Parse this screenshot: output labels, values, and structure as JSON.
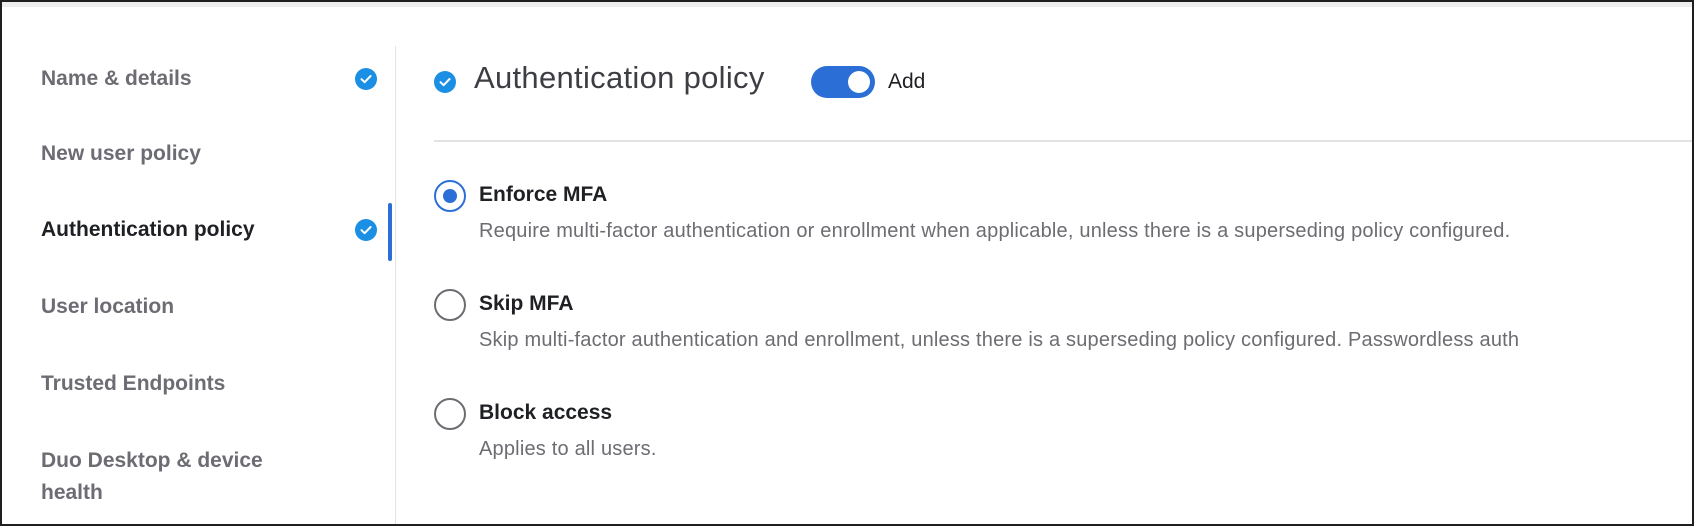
{
  "sidebar": {
    "items": [
      {
        "label": "Name & details",
        "checked": true,
        "active": false
      },
      {
        "label": "New user policy",
        "checked": false,
        "active": false
      },
      {
        "label": "Authentication policy",
        "checked": true,
        "active": true
      },
      {
        "label": "User location",
        "checked": false,
        "active": false
      },
      {
        "label": "Trusted Endpoints",
        "checked": false,
        "active": false
      },
      {
        "label": "Duo Desktop & device health",
        "checked": false,
        "active": false
      }
    ]
  },
  "header": {
    "title": "Authentication policy",
    "toggle_label": "Add",
    "toggle_on": true
  },
  "options": [
    {
      "title": "Enforce MFA",
      "description": "Require multi-factor authentication or enrollment when applicable, unless there is a superseding policy configured.",
      "selected": true
    },
    {
      "title": "Skip MFA",
      "description": "Skip multi-factor authentication and enrollment, unless there is a superseding policy configured. Passwordless auth",
      "selected": false
    },
    {
      "title": "Block access",
      "description": "Applies to all users.",
      "selected": false
    }
  ],
  "colors": {
    "accent": "#2b6fd6",
    "check": "#1a8fe3",
    "text_dark": "#1f2024",
    "text_muted": "#6c6c72"
  },
  "icons": {
    "completed": "check-circle-icon"
  }
}
